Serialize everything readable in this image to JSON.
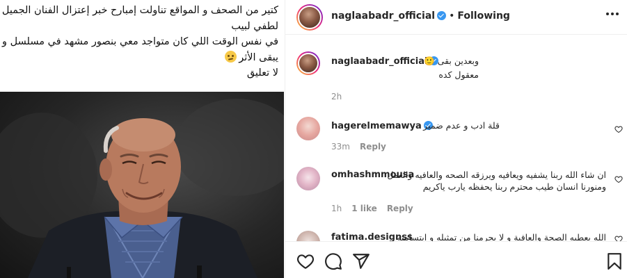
{
  "caption": {
    "lines": [
      "كتير من الصحف و المواقع تناولت إمبارح خبر إعتزال الفنان الجميل",
      "لطفي لبيب",
      "في نفس الوقت اللي كان متواجد معي بنصور مشهد في مسلسل و",
      "يبقى الأثر",
      "لا تعليق"
    ],
    "emoji": "thinking-face"
  },
  "header": {
    "username": "naglaabadr_official",
    "separator": "•",
    "follow_status": "Following",
    "more_icon": "more-horizontal-icon"
  },
  "comments": [
    {
      "username": "naglaabadr_official",
      "verified": true,
      "text": "وبعدين بقى 🙂",
      "text2": "معقول كده",
      "time": "2h"
    },
    {
      "username": "hagerelmemawya",
      "verified": true,
      "text": "قلة ادب و عدم ضمير",
      "time": "33m",
      "reply": "Reply"
    },
    {
      "username": "omhashmmousa",
      "verified": false,
      "text": "ان شاء الله ربنا يشفيه ويعافيه ويرزقه الصحه والعافيه والعمل",
      "text2": "ومنورنا انسان طيب محترم ربنا يحفظه يارب ياكريم",
      "time": "1h",
      "likes": "1 like",
      "reply": "Reply"
    },
    {
      "username": "fatima.designss",
      "verified": false,
      "text": "الله يعطيه الصحة والعافية و لا يحرمنا من تمثيله و ابتسامته"
    }
  ],
  "actions": {
    "like_icon": "heart-icon",
    "comment_icon": "comment-icon",
    "share_icon": "send-icon",
    "save_icon": "bookmark-icon"
  },
  "colors": {
    "text": "#262626",
    "muted": "#8e8e8e",
    "verified": "#3897f0",
    "border": "#efefef"
  }
}
